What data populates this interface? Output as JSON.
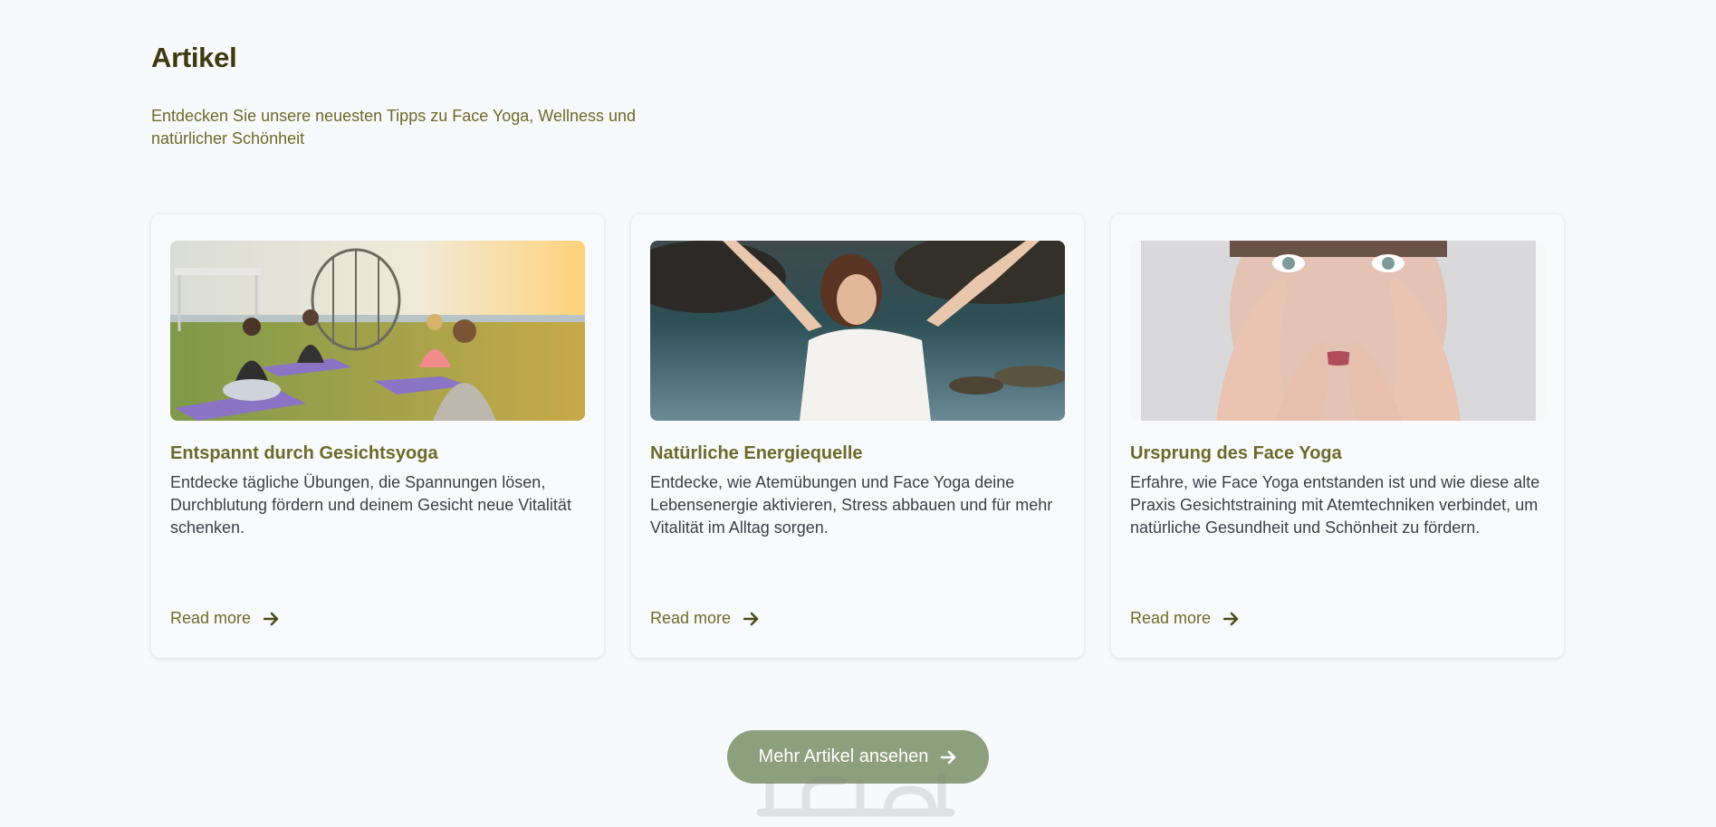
{
  "header": {
    "title": "Artikel",
    "subtitle": "Entdecken Sie unsere neuesten Tipps zu Face Yoga, Wellness und natürlicher Schönheit"
  },
  "articles": [
    {
      "title": "Entspannt durch Gesichtsyoga",
      "text": "Entdecke tägliche Übungen, die Spannungen lösen, Durchblutung fördern und deinem Gesicht neue Vitalität schenken.",
      "link_label": "Read more",
      "image": "group-meditation-sunset-photo"
    },
    {
      "title": "Natürliche Energiequelle",
      "text": "Entdecke, wie Atemübungen und Face Yoga deine Lebensenergie aktivieren, Stress abbauen und für mehr Vitalität im Alltag sorgen.",
      "link_label": "Read more",
      "image": "woman-arms-raised-sea-photo"
    },
    {
      "title": "Ursprung des Face Yoga",
      "text": "Erfahre, wie Face Yoga entstanden ist und wie diese alte Praxis Gesichtstraining mit Atemtechniken verbindet, um natürliche Gesundheit und Schönheit zu fördern.",
      "link_label": "Read more",
      "image": "face-yoga-hands-photo"
    }
  ],
  "cta": {
    "label": "Mehr Artikel ansehen",
    "icon": "arrow-right-icon"
  },
  "colors": {
    "background": "#f8f9fb",
    "title": "#3d3a12",
    "accent": "#6c6a2a",
    "button": "#8da07e"
  }
}
